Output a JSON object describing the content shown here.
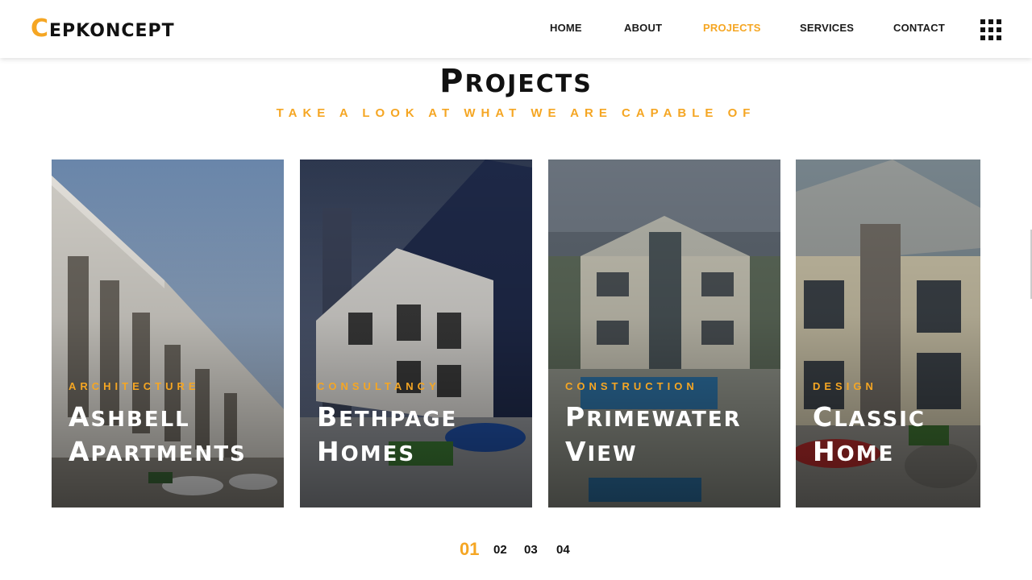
{
  "brand": {
    "first_letter": "C",
    "rest": "EPKONCEPT",
    "accent": "#f5a623"
  },
  "nav": {
    "items": [
      {
        "label": "HOME",
        "active": false
      },
      {
        "label": "ABOUT",
        "active": false
      },
      {
        "label": "PROJECTS",
        "active": true
      },
      {
        "label": "SERVICES",
        "active": false
      },
      {
        "label": "CONTACT",
        "active": false
      }
    ],
    "menu_icon": "grid-menu-icon"
  },
  "section": {
    "title_first": "P",
    "title_rest": "ROJECTS",
    "subtitle": "TAKE A LOOK AT WHAT WE ARE CAPABLE OF"
  },
  "projects": [
    {
      "category": "ARCHITECTURE",
      "title_l1_first": "A",
      "title_l1_rest": "SHBELL",
      "title_l2_first": "A",
      "title_l2_rest": "PARTMENTS"
    },
    {
      "category": "CONSULTANCY",
      "title_l1_first": "B",
      "title_l1_rest": "ETHPAGE",
      "title_l2_first": "H",
      "title_l2_rest": "OMES"
    },
    {
      "category": "CONSTRUCTION",
      "title_l1_first": "P",
      "title_l1_rest": "RIMEWATER",
      "title_l2_first": "V",
      "title_l2_rest": "IEW"
    },
    {
      "category": "DESIGN",
      "title_l1_first": "C",
      "title_l1_rest": "LASSIC",
      "title_l2_first": "H",
      "title_l2_rest": "OME"
    }
  ],
  "pagination": {
    "pages": [
      "01",
      "02",
      "03",
      "04"
    ],
    "active": "01"
  }
}
